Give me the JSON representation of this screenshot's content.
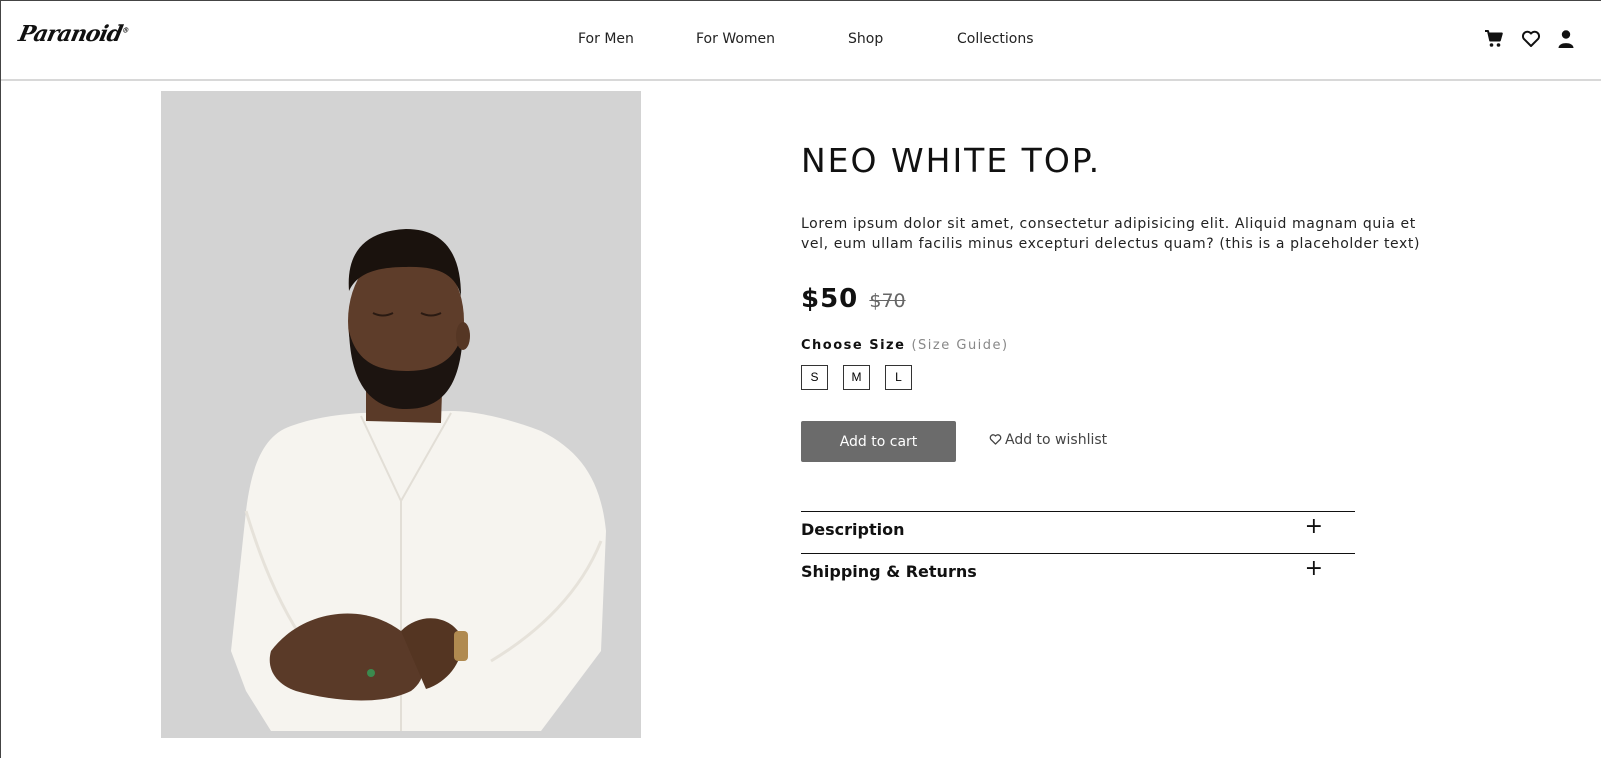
{
  "brand": {
    "logo_text": "Paranoid"
  },
  "nav": {
    "items": [
      {
        "label": "For Men"
      },
      {
        "label": "For Women"
      },
      {
        "label": "Shop"
      },
      {
        "label": "Collections"
      }
    ]
  },
  "header_icons": [
    "cart-icon",
    "heart-icon",
    "user-icon"
  ],
  "product": {
    "title": "NEO WHITE TOP.",
    "description": "Lorem ipsum dolor sit amet, consectetur adipisicing elit. Aliquid magnam quia et vel, eum ullam facilis minus excepturi delectus quam? (this is a placeholder text)",
    "price": "$50",
    "old_price": "$70",
    "size_label": "Choose Size",
    "size_guide": "(Size Guide)",
    "sizes": [
      "S",
      "M",
      "L"
    ],
    "add_to_cart": "Add to cart",
    "add_to_wishlist": "Add to wishlist",
    "sections": [
      {
        "label": "Description",
        "toggle": "+"
      },
      {
        "label": "Shipping & Returns",
        "toggle": "+"
      }
    ]
  },
  "colors": {
    "image_bg": "#d3d3d3",
    "button_bg": "#6b6b6b",
    "header_border": "#d8d8d8"
  }
}
